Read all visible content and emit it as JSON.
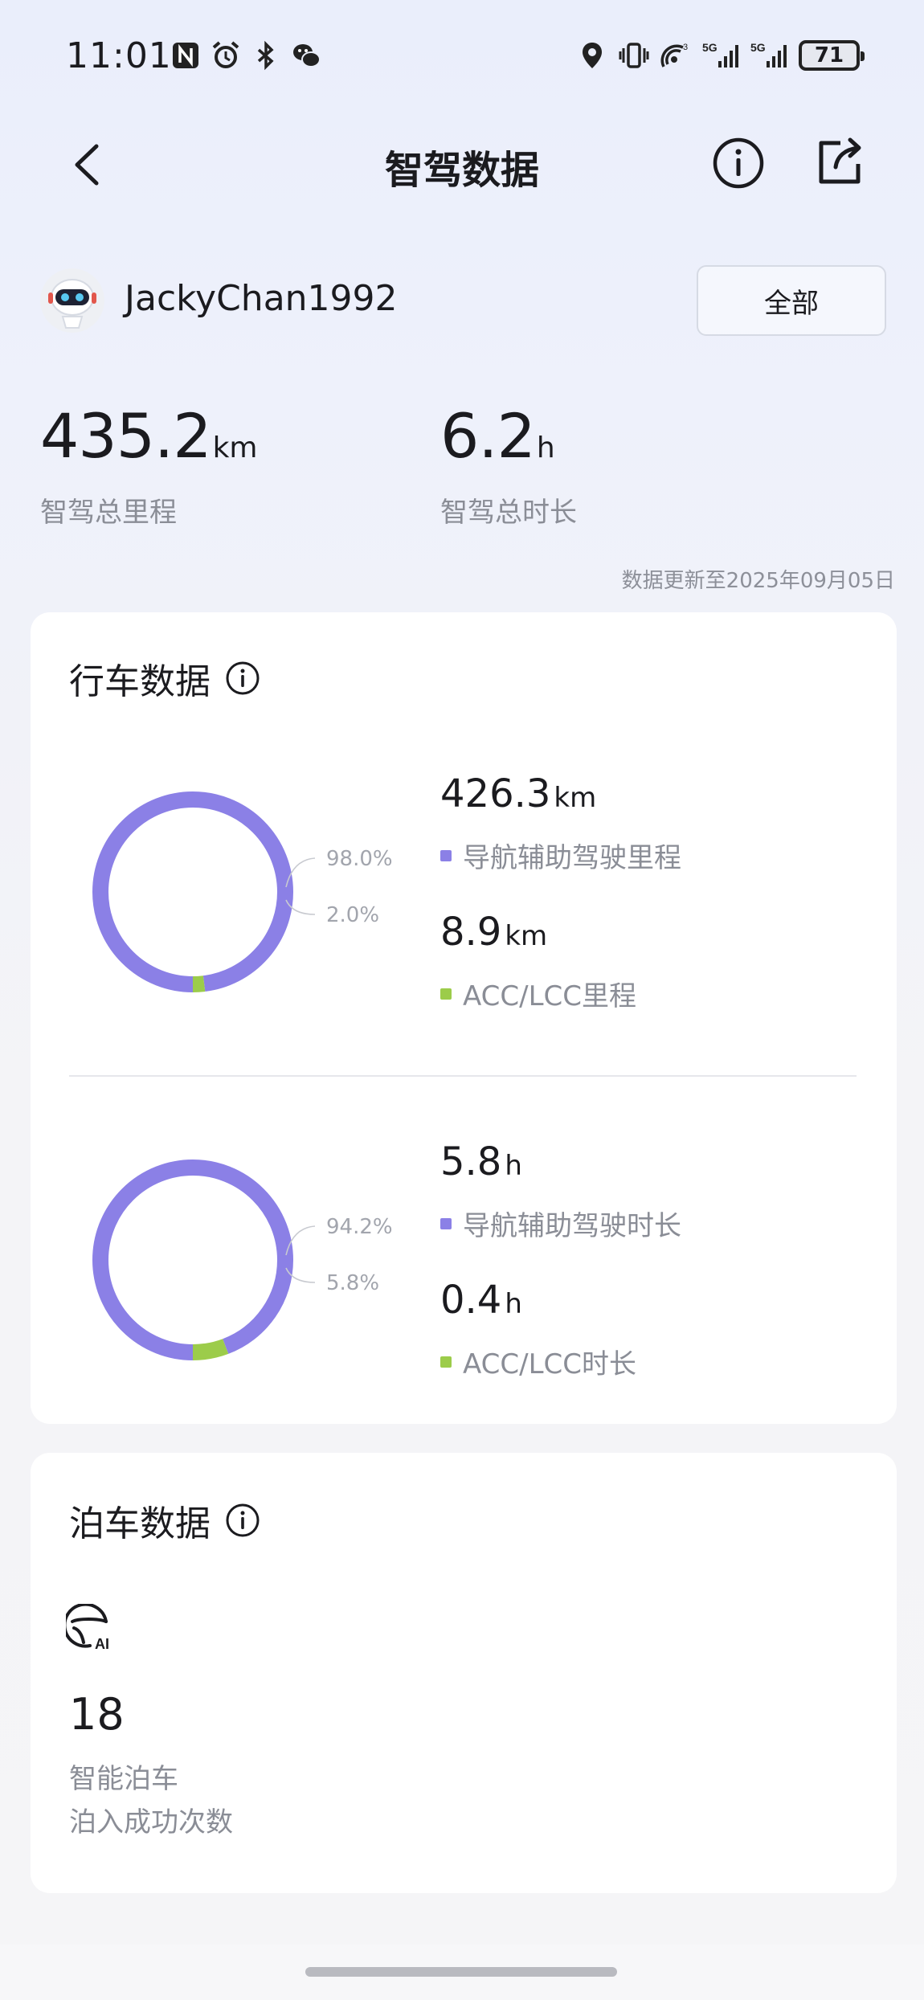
{
  "status_bar": {
    "time": "11:01",
    "network_a": "5G",
    "network_b": "5G",
    "hotspot_count": "3",
    "battery": "71"
  },
  "header": {
    "title": "智驾数据"
  },
  "user": {
    "name": "JackyChan1992",
    "filter_label": "全部"
  },
  "totals": {
    "distance_value": "435.2",
    "distance_unit": "km",
    "distance_label": "智驾总里程",
    "duration_value": "6.2",
    "duration_unit": "h",
    "duration_label": "智驾总时长",
    "update_note": "数据更新至2025年09月05日"
  },
  "driving": {
    "title": "行车数据",
    "colors": {
      "primary": "#8b80e6",
      "secondary": "#9ccc4a"
    },
    "mileage": {
      "primary_pct_text": "98.0%",
      "secondary_pct_text": "2.0%",
      "primary_fraction": 0.98,
      "primary_value": "426.3",
      "primary_unit": "km",
      "primary_label": "导航辅助驾驶里程",
      "secondary_value": "8.9",
      "secondary_unit": "km",
      "secondary_label": "ACC/LCC里程"
    },
    "duration": {
      "primary_pct_text": "94.2%",
      "secondary_pct_text": "5.8%",
      "primary_fraction": 0.942,
      "primary_value": "5.8",
      "primary_unit": "h",
      "primary_label": "导航辅助驾驶时长",
      "secondary_value": "0.4",
      "secondary_unit": "h",
      "secondary_label": "ACC/LCC时长"
    }
  },
  "parking": {
    "title": "泊车数据",
    "count": "18",
    "label_line1": "智能泊车",
    "label_line2": "泊入成功次数"
  }
}
